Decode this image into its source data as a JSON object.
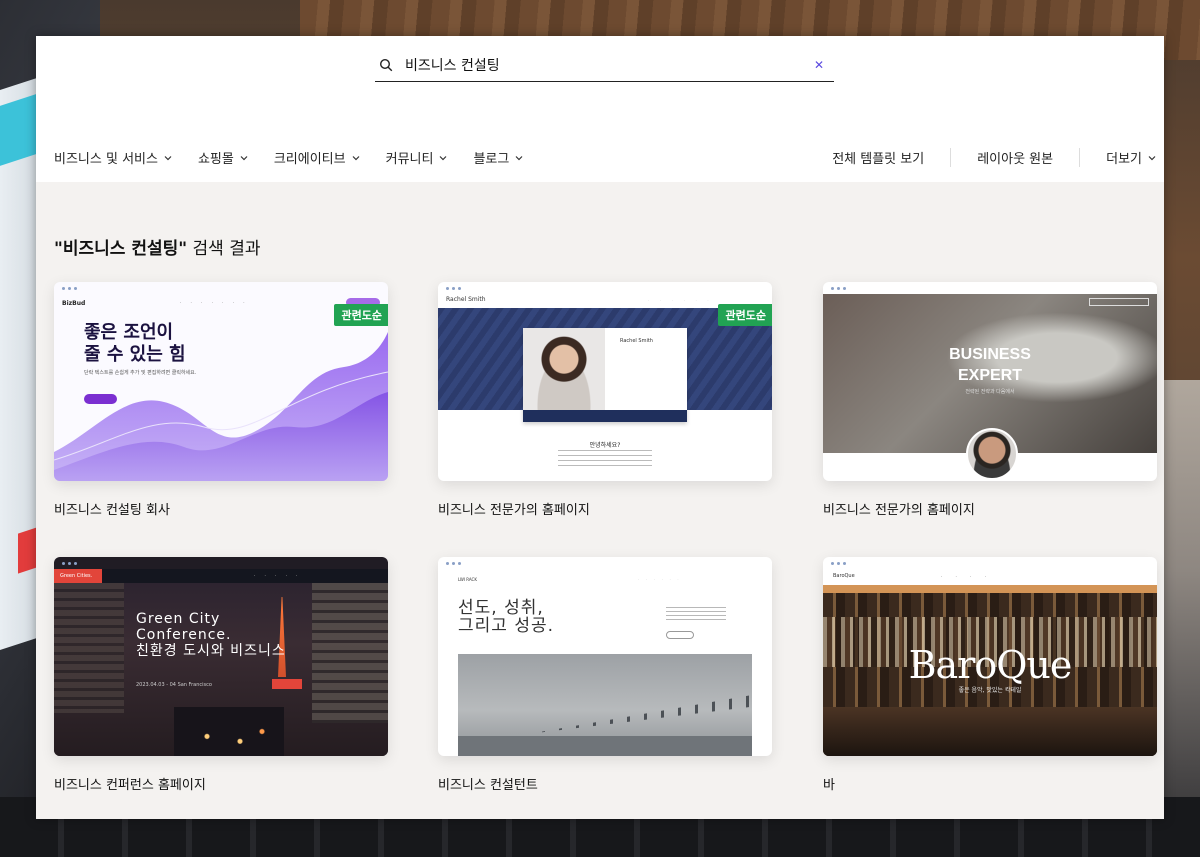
{
  "search": {
    "query": "비즈니스 컨설팅",
    "clear_icon": "close-icon"
  },
  "nav": {
    "left": [
      "비즈니스 및 서비스",
      "쇼핑몰",
      "크리에이티브",
      "커뮤니티",
      "블로그"
    ],
    "right": [
      "전체 템플릿 보기",
      "레이아웃 원본",
      "더보기"
    ]
  },
  "results": {
    "query": "\"비즈니스 컨설팅\"",
    "suffix": " 검색 결과"
  },
  "badge_color": "#21a353",
  "cards": [
    {
      "title": "비즈니스 컨설팅 회사",
      "badge": "관련도순",
      "thumb": {
        "logo": "BizBud",
        "headline_1": "좋은 조언이",
        "headline_2": "줄 수 있는 힘",
        "sub": "단락 텍스트를 손쉽게 추가 및 편집하려면 클릭하세요."
      }
    },
    {
      "title": "비즈니스 전문가의 홈페이지",
      "badge": "관련도순",
      "thumb": {
        "name": "Rachel Smith",
        "question": "안녕하세요?",
        "info": "Rachel Smith"
      }
    },
    {
      "title": "비즈니스 전문가의 홈페이지",
      "thumb": {
        "line1": "BUSINESS",
        "line2": "EXPERT",
        "sub": "전략된 전략과 다음에서"
      }
    },
    {
      "title": "비즈니스 컨퍼런스 홈페이지",
      "thumb": {
        "logo": "Green Cities.",
        "line1": "Green City",
        "line2": "Conference.",
        "line3": "친환경 도시와 비즈니스",
        "meta": "2023.04.03 - 04   San Francisco"
      }
    },
    {
      "title": "비즈니스 컨설턴트",
      "thumb": {
        "logo": "LWI RACK",
        "line1": "선도, 성취,",
        "line2": "그리고 성공."
      }
    },
    {
      "title": "바",
      "thumb": {
        "logo": "BaroQue",
        "word": "BaroQue",
        "tag": "좋은 음악, 맛있는 칵테일"
      }
    }
  ]
}
